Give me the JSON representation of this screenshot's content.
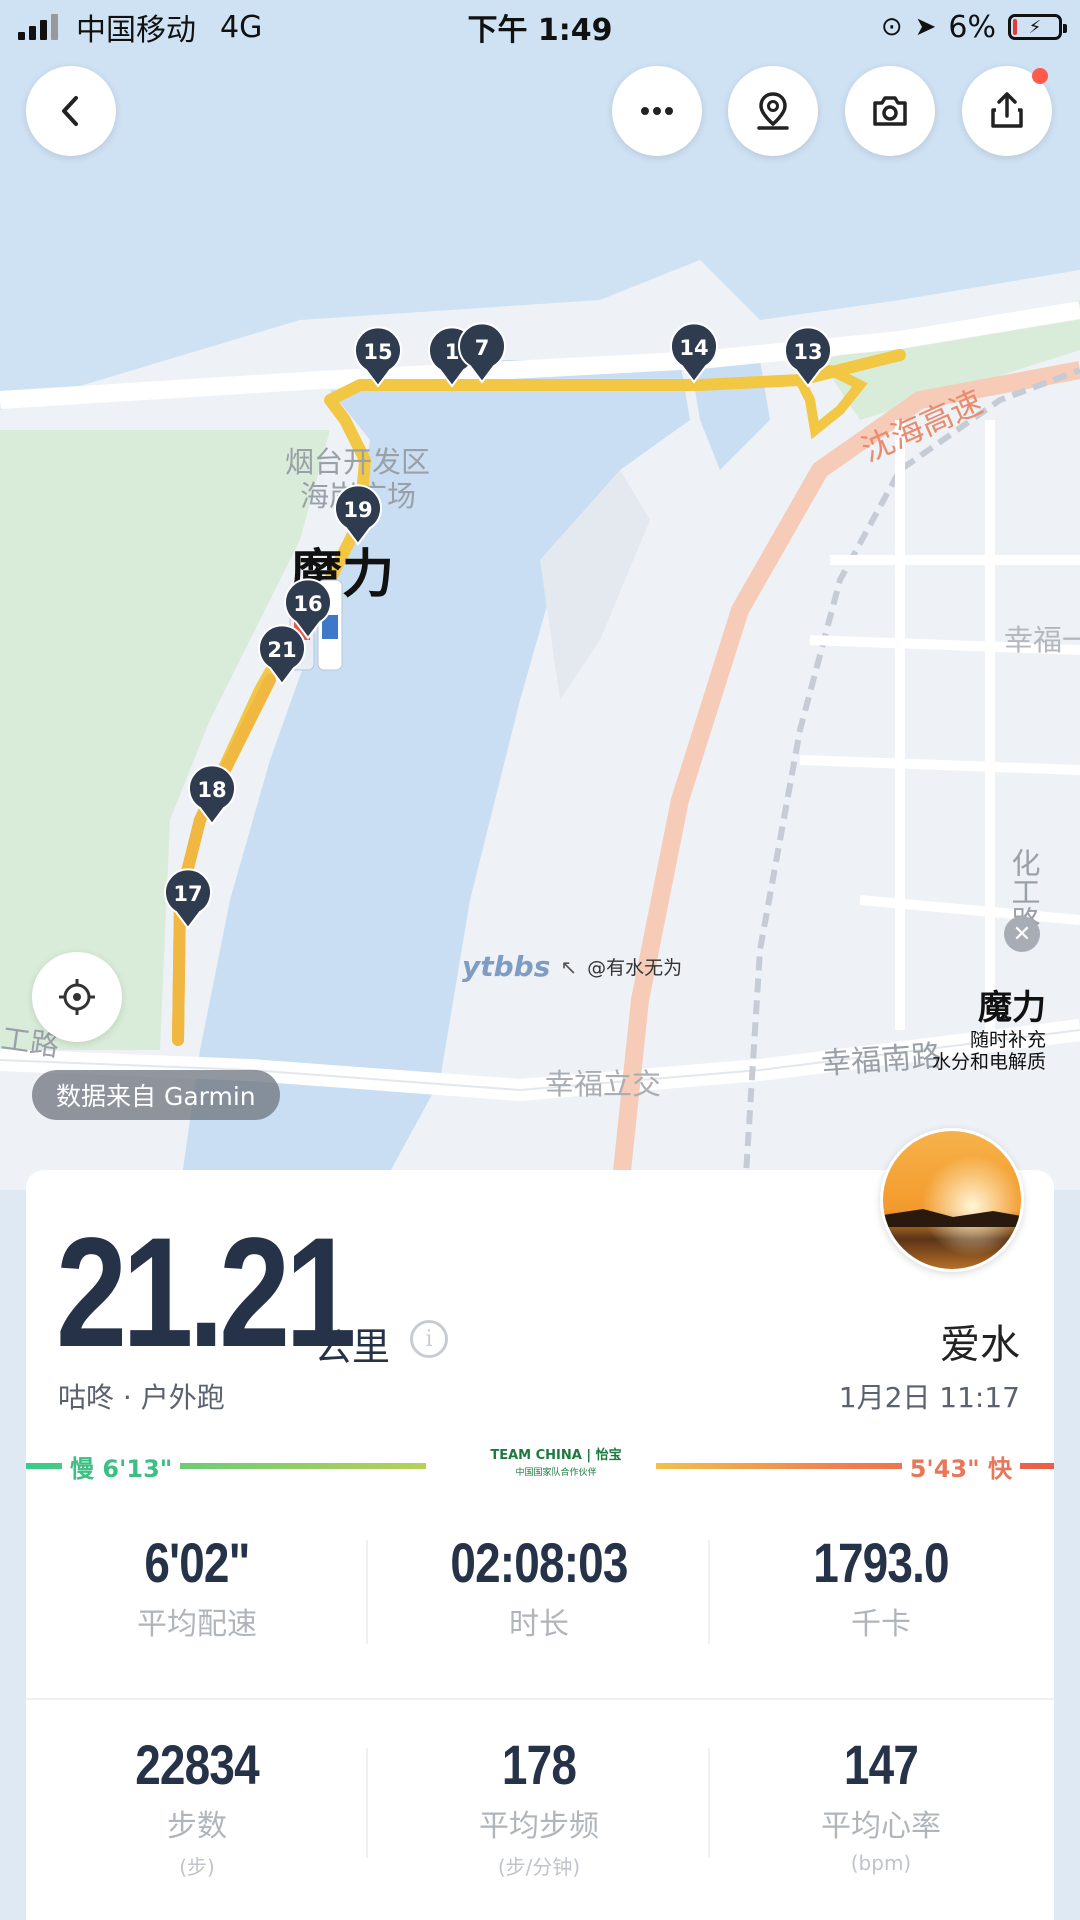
{
  "status_bar": {
    "carrier": "中国移动",
    "network": "4G",
    "time": "下午 1:49",
    "battery_percent": "6%"
  },
  "header": {
    "icons": {
      "back": "chevron-left-icon",
      "more": "more-dots-icon",
      "map": "map-pin-icon",
      "camera": "camera-icon",
      "share": "share-icon"
    },
    "accent_dot_color": "#ff5a4e"
  },
  "map": {
    "labels": {
      "district_1": "烟台开发区",
      "district_2": "海岸广场",
      "highway": "沈海高速",
      "road_right": "幸福一",
      "road_vertical": "化工路",
      "road_bottom_right": "幸福南路",
      "interchange": "幸福立交",
      "road_left": "工路",
      "brand": "魔力"
    },
    "markers": [
      "15",
      "1",
      "7",
      "14",
      "13",
      "19",
      "16",
      "21",
      "18",
      "17"
    ],
    "route_color": "#f2c744",
    "source_label": "数据来自 Garmin",
    "watermark_logo": "ytbbs",
    "watermark_text": "@有水无为"
  },
  "ad": {
    "title": "魔力",
    "line1": "随时补充",
    "line2": "水分和电解质"
  },
  "summary": {
    "distance": "21.21",
    "unit": "公里",
    "info_icon": "info-circle-icon",
    "app_type": "咕咚 · 户外跑",
    "username": "爱水",
    "datetime": "1月2日 11:17"
  },
  "pace_scale": {
    "slow_label": "慢 6'13\"",
    "fast_label": "5'43\" 快",
    "logo_main": "TEAM CHINA | 怡宝",
    "logo_sub": "中国国家队合作伙伴",
    "slow_color": "#3cc98a",
    "fast_color": "#e85e4a"
  },
  "stats": [
    {
      "value": "6'02\"",
      "label": "平均配速",
      "unit": ""
    },
    {
      "value": "02:08:03",
      "label": "时长",
      "unit": ""
    },
    {
      "value": "1793.0",
      "label": "千卡",
      "unit": ""
    },
    {
      "value": "22834",
      "label": "步数",
      "unit": "(步)"
    },
    {
      "value": "178",
      "label": "平均步频",
      "unit": "(步/分钟)"
    },
    {
      "value": "147",
      "label": "平均心率",
      "unit": "(bpm)"
    }
  ]
}
